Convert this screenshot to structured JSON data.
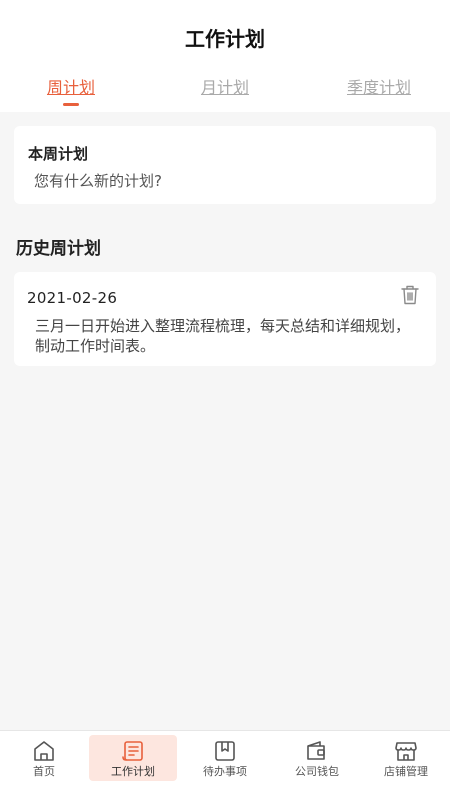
{
  "header": {
    "title": "工作计划"
  },
  "tabs": [
    {
      "label": "周计划",
      "active": true
    },
    {
      "label": "月计划",
      "active": false
    },
    {
      "label": "季度计划",
      "active": false
    }
  ],
  "current_plan": {
    "title": "本周计划",
    "input_placeholder": "您有什么新的计划?"
  },
  "history": {
    "section_title": "历史周计划",
    "items": [
      {
        "date": "2021-02-26",
        "content": "三月一日开始进入整理流程梳理，每天总结和详细规划，制动工作时间表。",
        "delete_icon": "trash-icon"
      }
    ]
  },
  "bottom_nav": {
    "items": [
      {
        "label": "首页",
        "icon": "home-icon",
        "active": false
      },
      {
        "label": "工作计划",
        "icon": "plan-document-icon",
        "active": true
      },
      {
        "label": "待办事项",
        "icon": "todo-book-icon",
        "active": false
      },
      {
        "label": "公司钱包",
        "icon": "wallet-icon",
        "active": false
      },
      {
        "label": "店铺管理",
        "icon": "store-icon",
        "active": false
      }
    ]
  },
  "colors": {
    "accent": "#e8603c",
    "active_nav_bg": "#fde6df",
    "background": "#f6f6f6",
    "inactive_tab": "#a9a9a9"
  }
}
